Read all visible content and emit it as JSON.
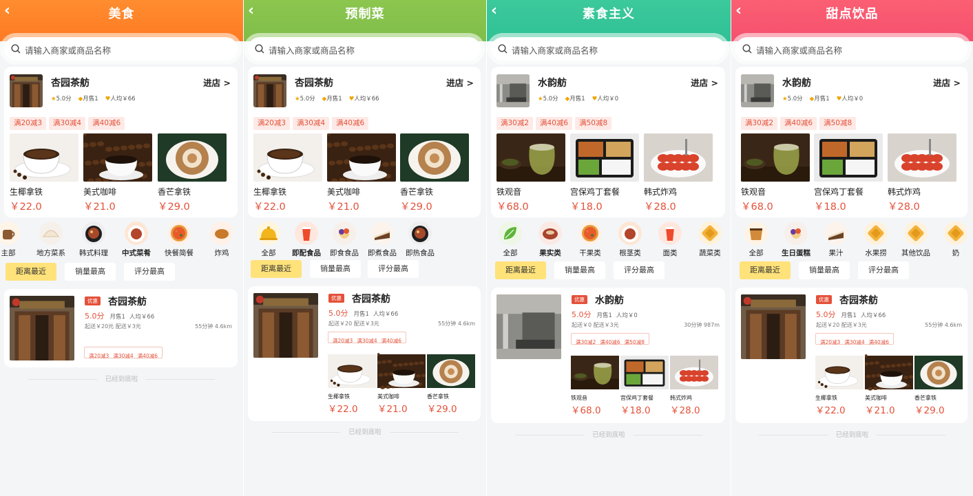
{
  "panels": [
    {
      "title": "美食",
      "header_gradient": [
        "#ff8a2d",
        "#ff7a22"
      ],
      "search_placeholder": "请输入商家或商品名称",
      "top_shop": {
        "name": "杏园茶舫",
        "enter": "进店 >",
        "rating": "5.0分",
        "monthly": "月售1",
        "avg": "人均￥66",
        "promos": [
          "满20减3",
          "满30减4",
          "满40减6"
        ],
        "products": [
          {
            "name": "生椰拿铁",
            "price": "￥22.0"
          },
          {
            "name": "美式咖啡",
            "price": "￥21.0"
          },
          {
            "name": "香芒拿铁",
            "price": "￥29.0"
          }
        ]
      },
      "categories": [
        {
          "label": "主部",
          "icon": "tea-icon"
        },
        {
          "label": "地方菜系",
          "icon": "dumpling-icon"
        },
        {
          "label": "韩式料理",
          "icon": "stew-icon"
        },
        {
          "label": "中式菜肴",
          "icon": "dish-icon"
        },
        {
          "label": "快餐简餐",
          "icon": "pizza-icon"
        },
        {
          "label": "炸鸡",
          "icon": "friedchicken-icon"
        }
      ],
      "sorts": [
        "距离最近",
        "销量最高",
        "评分最高"
      ],
      "list_shop": {
        "badge": "优惠",
        "name": "杏园茶舫",
        "score": "5.0分",
        "monthly": "月售1",
        "avg": "人均￥66",
        "delivery": "起送￥20元 配送￥3元",
        "distance": "55分钟 4.6km",
        "promos": [
          "满20减3",
          "满30减4",
          "满40减6"
        ],
        "products": []
      },
      "end_text": "已经到底啦"
    },
    {
      "title": "预制菜",
      "search_placeholder": "请输入商家或商品名称",
      "top_shop": {
        "name": "杏园茶舫",
        "enter": "进店 >",
        "rating": "5.0分",
        "monthly": "月售1",
        "avg": "人均￥66",
        "promos": [
          "满20减3",
          "满30减4",
          "满40减6"
        ],
        "products": [
          {
            "name": "生椰拿铁",
            "price": "￥22.0"
          },
          {
            "name": "美式咖啡",
            "price": "￥21.0"
          },
          {
            "name": "香芒拿铁",
            "price": "￥29.0"
          }
        ]
      },
      "categories": [
        {
          "label": "全部",
          "icon": "bell-icon"
        },
        {
          "label": "即配食品",
          "icon": "drink-icon"
        },
        {
          "label": "即食食品",
          "icon": "icecream-icon"
        },
        {
          "label": "即煮食品",
          "icon": "cake-icon"
        },
        {
          "label": "即热食品",
          "icon": "stew-icon"
        }
      ],
      "sorts": [
        "距离最近",
        "销量最高",
        "评分最高"
      ],
      "list_shop": {
        "badge": "优惠",
        "name": "杏园茶舫",
        "score": "5.0分",
        "monthly": "月售1",
        "avg": "人均￥66",
        "delivery": "起送￥20 配送￥3元",
        "distance": "55分钟 4.6km",
        "promos": [
          "满20减3",
          "满30减4",
          "满40减6"
        ],
        "products": [
          {
            "name": "生椰拿铁",
            "price": "￥22.0"
          },
          {
            "name": "美式咖啡",
            "price": "￥21.0"
          },
          {
            "name": "香芒拿铁",
            "price": "￥29.0"
          }
        ]
      },
      "end_text": "已经到底啦"
    },
    {
      "title": "素食主义",
      "search_placeholder": "请输入商家或商品名称",
      "top_shop": {
        "name": "水韵舫",
        "enter": "进店 >",
        "rating": "5.0分",
        "monthly": "月售1",
        "avg": "人均￥0",
        "promos": [
          "满30减2",
          "满40减6",
          "满50减8"
        ],
        "products": [
          {
            "name": "铁观音",
            "price": "￥68.0"
          },
          {
            "name": "宫保鸡丁套餐",
            "price": "￥18.0"
          },
          {
            "name": "韩式炸鸡",
            "price": "￥28.0"
          }
        ]
      },
      "categories": [
        {
          "label": "全部",
          "icon": "leaf-icon"
        },
        {
          "label": "果实类",
          "icon": "meat-icon"
        },
        {
          "label": "干果类",
          "icon": "pizza-icon"
        },
        {
          "label": "根茎类",
          "icon": "dish-icon"
        },
        {
          "label": "面类",
          "icon": "drink-icon"
        },
        {
          "label": "蔬菜类",
          "icon": "waffle-icon"
        }
      ],
      "sorts": [
        "距离最近",
        "销量最高",
        "评分最高"
      ],
      "list_shop": {
        "badge": "优惠",
        "name": "水韵舫",
        "score": "5.0分",
        "monthly": "月售1",
        "avg": "人均￥0",
        "delivery": "起送￥0 配送￥3元",
        "distance": "30分钟 987m",
        "promos": [
          "满30减2",
          "满40减6",
          "满50减8"
        ],
        "products": [
          {
            "name": "铁观音",
            "price": "￥68.0"
          },
          {
            "name": "宫保鸡丁套餐",
            "price": "￥18.0"
          },
          {
            "name": "韩式炸鸡",
            "price": "￥28.0"
          }
        ]
      },
      "end_text": "已经到底啦"
    },
    {
      "title": "甜点饮品",
      "search_placeholder": "请输入商家或商品名称",
      "top_shop": {
        "name": "水韵舫",
        "enter": "进店 >",
        "rating": "5.0分",
        "monthly": "月售1",
        "avg": "人均￥0",
        "promos": [
          "满30减2",
          "满40减6",
          "满50减8"
        ],
        "products": [
          {
            "name": "铁观音",
            "price": "￥68.0"
          },
          {
            "name": "宫保鸡丁套餐",
            "price": "￥18.0"
          },
          {
            "name": "韩式炸鸡",
            "price": "￥28.0"
          }
        ]
      },
      "categories": [
        {
          "label": "全部",
          "icon": "cup-icon"
        },
        {
          "label": "生日蛋糕",
          "icon": "icecream-icon"
        },
        {
          "label": "果汁",
          "icon": "cake-icon"
        },
        {
          "label": "水果捞",
          "icon": "waffle-icon"
        },
        {
          "label": "其他饮品",
          "icon": "waffle-icon"
        },
        {
          "label": "奶",
          "icon": "waffle-icon"
        }
      ],
      "sorts": [
        "距离最近",
        "销量最高",
        "评分最高"
      ],
      "list_shop": {
        "badge": "优惠",
        "name": "杏园茶舫",
        "score": "5.0分",
        "monthly": "月售1",
        "avg": "人均￥66",
        "delivery": "起送￥20 配送￥3元",
        "distance": "55分钟 4.6km",
        "promos": [
          "满20减3",
          "满30减4",
          "满40减6"
        ],
        "products": [
          {
            "name": "生椰拿铁",
            "price": "￥22.0"
          },
          {
            "name": "美式咖啡",
            "price": "￥21.0"
          },
          {
            "name": "香芒拿铁",
            "price": "￥29.0"
          }
        ]
      },
      "end_text": "已经到底啦"
    }
  ],
  "colors": {
    "price": "#e4513a",
    "active_sort": "#ffe27a",
    "header_food": "#ff7f27",
    "header_prepared": "#86c24d",
    "header_veg": "#35c59a",
    "header_dessert": "#f85a73"
  }
}
